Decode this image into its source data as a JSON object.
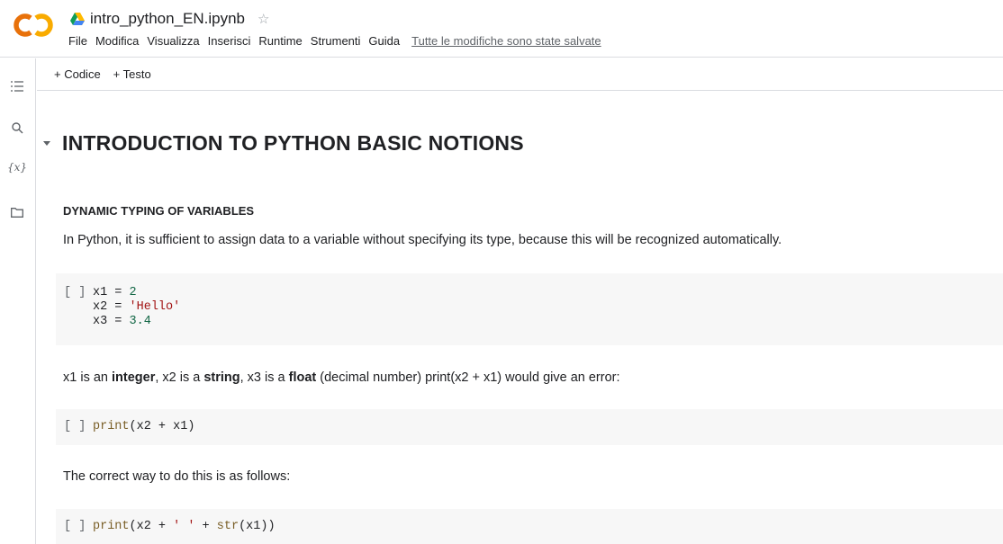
{
  "header": {
    "title": "intro_python_EN.ipynb",
    "menu": [
      "File",
      "Modifica",
      "Visualizza",
      "Inserisci",
      "Runtime",
      "Strumenti",
      "Guida"
    ],
    "saved_status": "Tutte le modifiche sono state salvate"
  },
  "toolbar": {
    "add_code": "+ Codice",
    "add_text": "+ Testo"
  },
  "notebook": {
    "heading": "INTRODUCTION TO PYTHON BASIC NOTIONS",
    "subheading": "DYNAMIC TYPING OF VARIABLES",
    "para1": "In Python, it is sufficient to assign data to a variable without specifying its type, because this will be recognized automatically.",
    "cell_bracket": "[ ]",
    "para2": {
      "t1": "x1 is an ",
      "b1": "integer",
      "t2": ", x2 is a ",
      "b2": "string",
      "t3": ", x3 is a ",
      "b3": "float",
      "t4": " (decimal number) print(x2 + x1) would give an error:"
    },
    "para3": "The correct way to do this is as follows:",
    "cell1": {
      "l1_a": "x1 = ",
      "l1_b": "2",
      "l2_a": "x2 = ",
      "l2_b": "'Hello'",
      "l3_a": "x3 = ",
      "l3_b": "3.4"
    },
    "cell2": {
      "a": "print",
      "b": "(x2 + x1)"
    },
    "cell3": {
      "a": "print",
      "b": "(x2 + ",
      "c": "' '",
      "d": " + ",
      "e": "str",
      "f": "(x1))"
    }
  },
  "colors": {
    "number": "#116644",
    "string": "#a31515",
    "function": "#795e26",
    "logo_orange": "#f9ab00",
    "logo_dark_orange": "#e8710a"
  },
  "icons": [
    "colab-logo",
    "drive-icon",
    "star-icon",
    "toc-icon",
    "search-icon",
    "variables-icon",
    "folder-icon",
    "collapse-chevron-icon"
  ]
}
